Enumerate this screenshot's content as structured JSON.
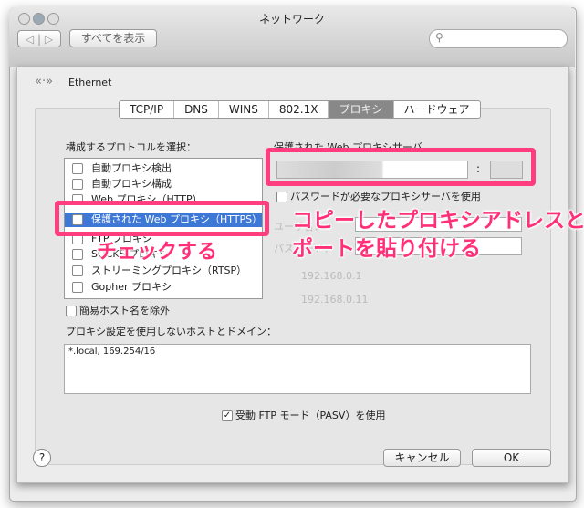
{
  "window": {
    "title": "ネットワーク",
    "show_all": "すべてを表示",
    "search_placeholder": ""
  },
  "sheet": {
    "interface": "Ethernet",
    "tabs": [
      {
        "label": "TCP/IP"
      },
      {
        "label": "DNS"
      },
      {
        "label": "WINS"
      },
      {
        "label": "802.1X"
      },
      {
        "label": "プロキシ",
        "selected": true
      },
      {
        "label": "ハードウェア"
      }
    ],
    "protocol_label": "構成するプロトコルを選択：",
    "protocols": [
      {
        "label": "自動プロキシ検出",
        "checked": false
      },
      {
        "label": "自動プロキシ構成",
        "checked": false
      },
      {
        "label": "Web プロキシ（HTTP）",
        "checked": false
      },
      {
        "label": "保護された Web プロキシ（HTTPS）",
        "checked": true,
        "selected": true
      },
      {
        "label": "FTP プロキシ",
        "checked": false
      },
      {
        "label": "SOCKS プロキシ",
        "checked": false
      },
      {
        "label": "ストリーミングプロキシ（RTSP）",
        "checked": false
      },
      {
        "label": "Gopher プロキシ",
        "checked": false
      }
    ],
    "server_label": "保護された Web プロキシサーバ",
    "server_value": "",
    "port_value": "",
    "colon": ":",
    "password_required": "パスワードが必要なプロキシサーバを使用",
    "username_label": "ユーザ名：",
    "password_label": "パスワード：",
    "exclude_simple": "簡易ホスト名を除外",
    "bypass_label": "プロキシ設定を使用しないホストとドメイン：",
    "bypass_value": "*.local, 169.254/16",
    "pasv": "受動 FTP モード（PASV）を使用",
    "help": "?",
    "cancel": "キャンセル",
    "ok": "OK"
  },
  "background": {
    "router": "192.168.0.1",
    "dns": "192.168.0.11"
  },
  "annotations": {
    "check": "チェックする",
    "paste_line1": "コピーしたプロキシアドレスと",
    "paste_line2": "ポートを貼り付ける"
  },
  "colors": {
    "annotation": "#ff3d7f",
    "selection": "#3d78d6"
  }
}
